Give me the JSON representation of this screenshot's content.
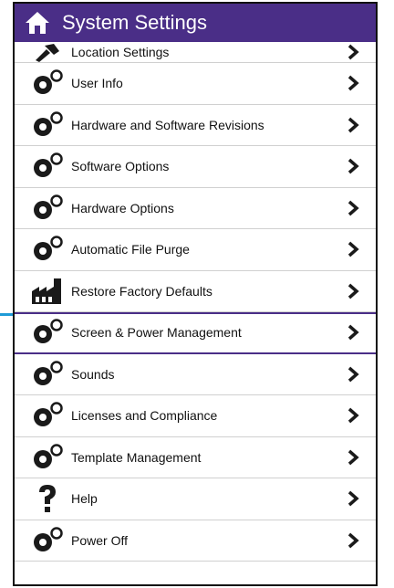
{
  "header": {
    "title": "System Settings"
  },
  "items": [
    {
      "label": "Location Settings",
      "icon": "location-wrench-icon"
    },
    {
      "label": "User Info",
      "icon": "gears-icon"
    },
    {
      "label": "Hardware and Software Revisions",
      "icon": "gears-icon"
    },
    {
      "label": "Software Options",
      "icon": "gears-icon"
    },
    {
      "label": "Hardware Options",
      "icon": "gears-icon"
    },
    {
      "label": "Automatic File Purge",
      "icon": "gears-icon"
    },
    {
      "label": "Restore Factory Defaults",
      "icon": "factory-icon"
    },
    {
      "label": "Screen & Power Management",
      "icon": "gears-icon",
      "selected": true
    },
    {
      "label": "Sounds",
      "icon": "gears-icon"
    },
    {
      "label": "Licenses and Compliance",
      "icon": "gears-icon"
    },
    {
      "label": "Template Management",
      "icon": "gears-icon"
    },
    {
      "label": "Help",
      "icon": "question-icon"
    },
    {
      "label": "Power Off",
      "icon": "gears-icon"
    }
  ],
  "colors": {
    "header": "#4a2e87",
    "pointer": "#1e9bd7",
    "icon": "#1a1a1a"
  }
}
